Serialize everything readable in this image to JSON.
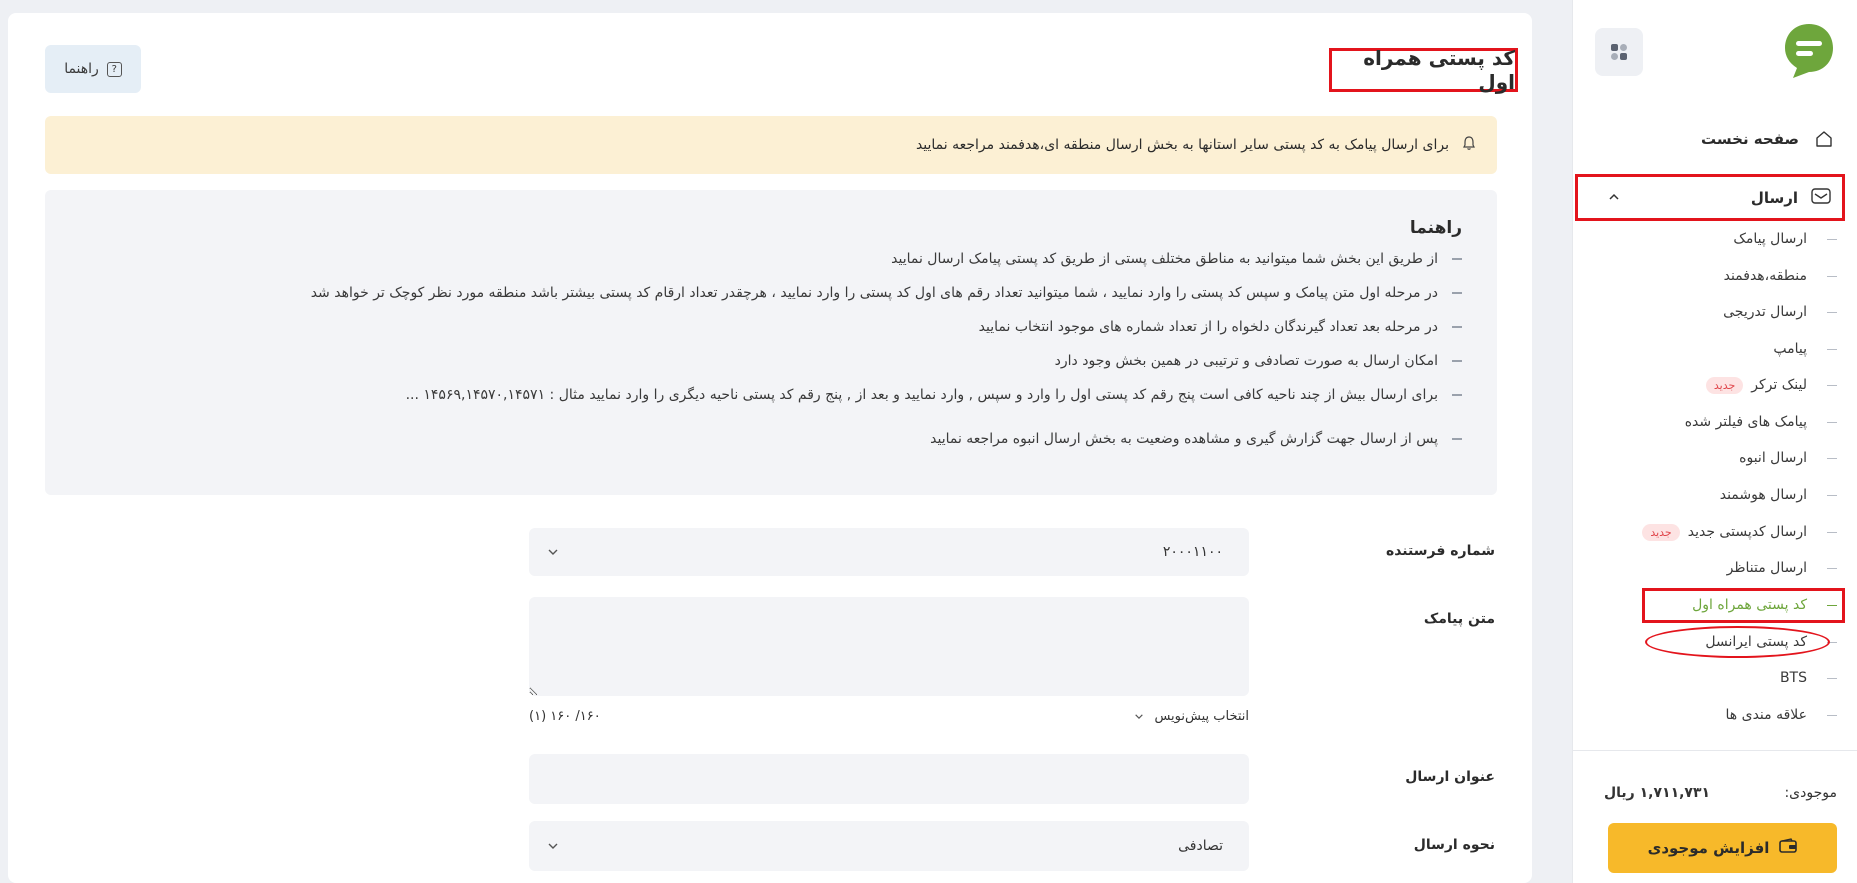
{
  "page": {
    "title": "کد پستی همراه اول",
    "help_label": "راهنما"
  },
  "alert": {
    "text": "برای ارسال پیامک به کد پستی سایر استانها به بخش ارسال منطقه ای،هدفمند مراجعه نمایید",
    "icon": "bell-icon"
  },
  "guide": {
    "title": "راهنما",
    "items": [
      "از طریق این بخش شما میتوانید به مناطق مختلف پستی از طریق کد پستی پیامک ارسال نمایید",
      "در مرحله اول متن پیامک و سپس کد پستی را وارد نمایید ، شما میتوانید تعداد رقم های اول کد پستی را وارد نمایید ، هرچقدر تعداد ارقام کد پستی بیشتر باشد منطقه مورد نظر کوچک تر خواهد شد",
      "در مرحله بعد تعداد گیرندگان دلخواه را از تعداد شماره های موجود انتخاب نمایید",
      "امکان ارسال به صورت تصادفی و ترتیبی در همین بخش وجود دارد",
      "برای ارسال بیش از چند ناحیه کافی است پنج رقم کد پستی اول را وارد و سپس , وارد نمایید و بعد از , پنج رقم کد پستی ناحیه دیگری را وارد نمایید مثال : ۱۴۵۶۹,۱۴۵۷۰,۱۴۵۷۱ ...",
      "پس از ارسال جهت گزارش گیری و مشاهده وضعیت به بخش ارسال انبوه مراجعه نمایید"
    ]
  },
  "form": {
    "sender_label": "شماره فرستنده",
    "sender_value": "۲۰۰۰۱۱۰۰",
    "message_label": "متن پیامک",
    "message_value": "",
    "template_picker": "انتخاب پیش‌نویس",
    "char_counter": "۱۶۰/ ۱۶۰",
    "sms_count": "(۱)",
    "subject_label": "عنوان ارسال",
    "subject_value": "",
    "method_label": "نحوه ارسال",
    "method_value": "تصادفی"
  },
  "sidebar": {
    "home": "صفحه نخست",
    "send": "ارسال",
    "sub_items": [
      {
        "label": "ارسال پیامک",
        "badge": ""
      },
      {
        "label": "منطقه،هدفمند",
        "badge": ""
      },
      {
        "label": "ارسال تدریجی",
        "badge": ""
      },
      {
        "label": "پیامپ",
        "badge": ""
      },
      {
        "label": "لینک ترکر",
        "badge": "جدید"
      },
      {
        "label": "پیامک های فیلتر شده",
        "badge": ""
      },
      {
        "label": "ارسال انبوه",
        "badge": ""
      },
      {
        "label": "ارسال هوشمند",
        "badge": ""
      },
      {
        "label": "ارسال کدپستی جدید",
        "badge": "جدید"
      },
      {
        "label": "ارسال متناظر",
        "badge": ""
      },
      {
        "label": "کد پستی همراه اول",
        "badge": ""
      },
      {
        "label": "کد پستی ایرانسل",
        "badge": ""
      },
      {
        "label": "BTS",
        "badge": ""
      },
      {
        "label": "علاقه مندی ها",
        "badge": ""
      }
    ],
    "balance_label": "موجودی:",
    "balance_value": "۱,۷۱۱,۷۳۱ ریال",
    "charge_button": "افزایش موجودی",
    "accent_color": "#6ea63c"
  }
}
